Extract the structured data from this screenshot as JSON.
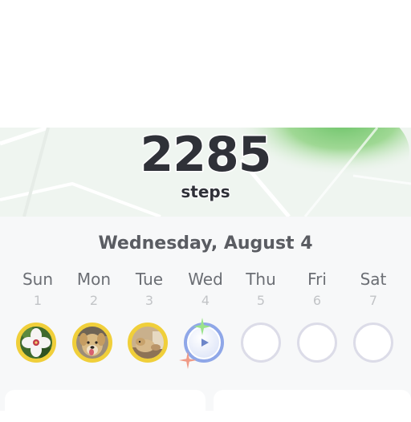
{
  "steps": {
    "count": "2285",
    "label": "steps"
  },
  "calendar": {
    "date_title": "Wednesday, August 4",
    "days": [
      {
        "name": "Sun",
        "number": "1",
        "status": "photo"
      },
      {
        "name": "Mon",
        "number": "2",
        "status": "photo"
      },
      {
        "name": "Tue",
        "number": "3",
        "status": "photo"
      },
      {
        "name": "Wed",
        "number": "4",
        "status": "today"
      },
      {
        "name": "Thu",
        "number": "5",
        "status": "empty"
      },
      {
        "name": "Fri",
        "number": "6",
        "status": "empty"
      },
      {
        "name": "Sat",
        "number": "7",
        "status": "empty"
      }
    ]
  },
  "colors": {
    "photo_ring": "#f0cf3a",
    "today_ring": "#8fa7e8",
    "empty_ring": "#dcdce8",
    "text_dark": "#2f3138"
  },
  "icons": {
    "sun": "hibiscus-flower-photo",
    "mon": "dog-photo",
    "tue": "dog-photo",
    "wed": "play-icon"
  }
}
